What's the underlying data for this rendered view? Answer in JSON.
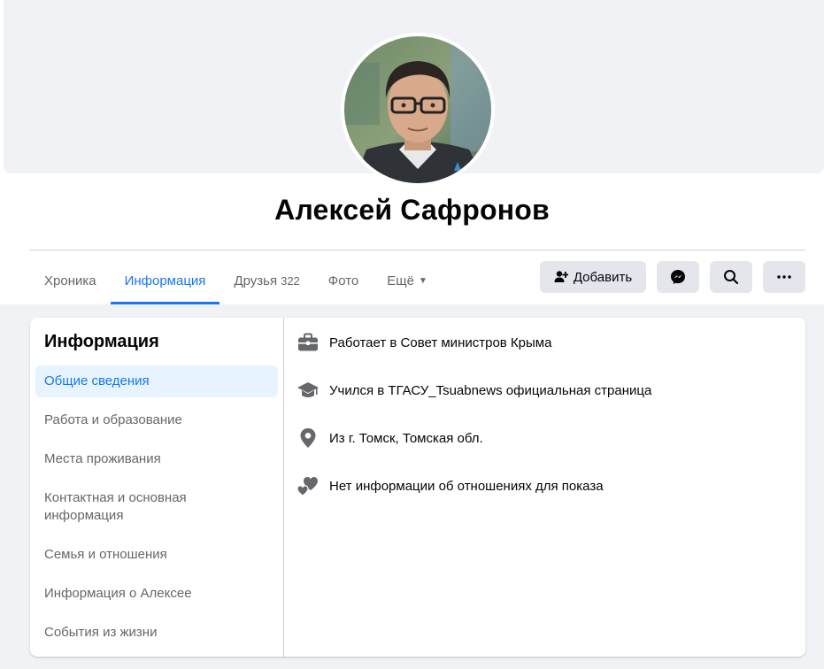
{
  "profile": {
    "name": "Алексей Сафронов"
  },
  "tabs": [
    {
      "label": "Хроника"
    },
    {
      "label": "Информация"
    },
    {
      "label": "Друзья",
      "count": "322"
    },
    {
      "label": "Фото"
    },
    {
      "label": "Ещё"
    }
  ],
  "actions": {
    "add_label": "Добавить"
  },
  "about": {
    "title": "Информация",
    "nav": [
      {
        "label": "Общие сведения"
      },
      {
        "label": "Работа и образование"
      },
      {
        "label": "Места проживания"
      },
      {
        "label": "Контактная и основная информация"
      },
      {
        "label": "Семья и отношения"
      },
      {
        "label": "Информация о Алексее"
      },
      {
        "label": "События из жизни"
      }
    ],
    "items": [
      {
        "icon": "briefcase-icon",
        "text": "Работает в Совет министров Крыма"
      },
      {
        "icon": "graduation-cap-icon",
        "text": "Учился в ТГАСУ_Tsuabnews официальная страница"
      },
      {
        "icon": "location-pin-icon",
        "text": "Из г. Томск, Томская обл."
      },
      {
        "icon": "hearts-icon",
        "text": "Нет информации об отношениях для показа"
      }
    ]
  },
  "colors": {
    "accent": "#1877f2",
    "icon_gray": "#65676b",
    "button_bg": "#e4e6eb",
    "page_bg": "#f0f2f5"
  }
}
